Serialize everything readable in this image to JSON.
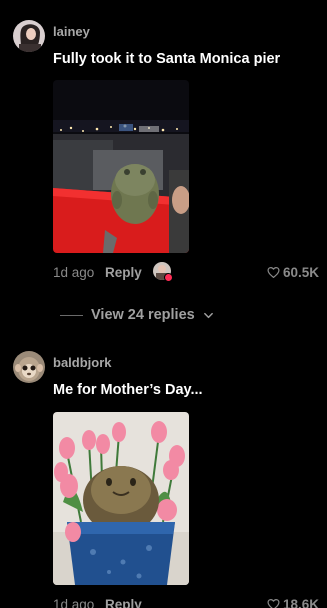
{
  "comments": [
    {
      "username": "lainey",
      "text": "Fully took it to Santa Monica pier",
      "time": "1d ago",
      "reply_label": "Reply",
      "likes": "60.5K",
      "photo_icon": "frog-figurine-at-pier-photo"
    },
    {
      "username": "baldbjork",
      "text": "Me for Mother’s Day...",
      "time": "1d ago",
      "reply_label": "Reply",
      "likes": "18.6K",
      "photo_icon": "frog-figurine-with-tulips-photo"
    }
  ],
  "view_replies": {
    "label": "View 24 replies",
    "icon": "chevron-down-icon"
  },
  "colors": {
    "background": "#000000",
    "muted_text": "#8a8a8a",
    "badge": "#fe2c55"
  }
}
